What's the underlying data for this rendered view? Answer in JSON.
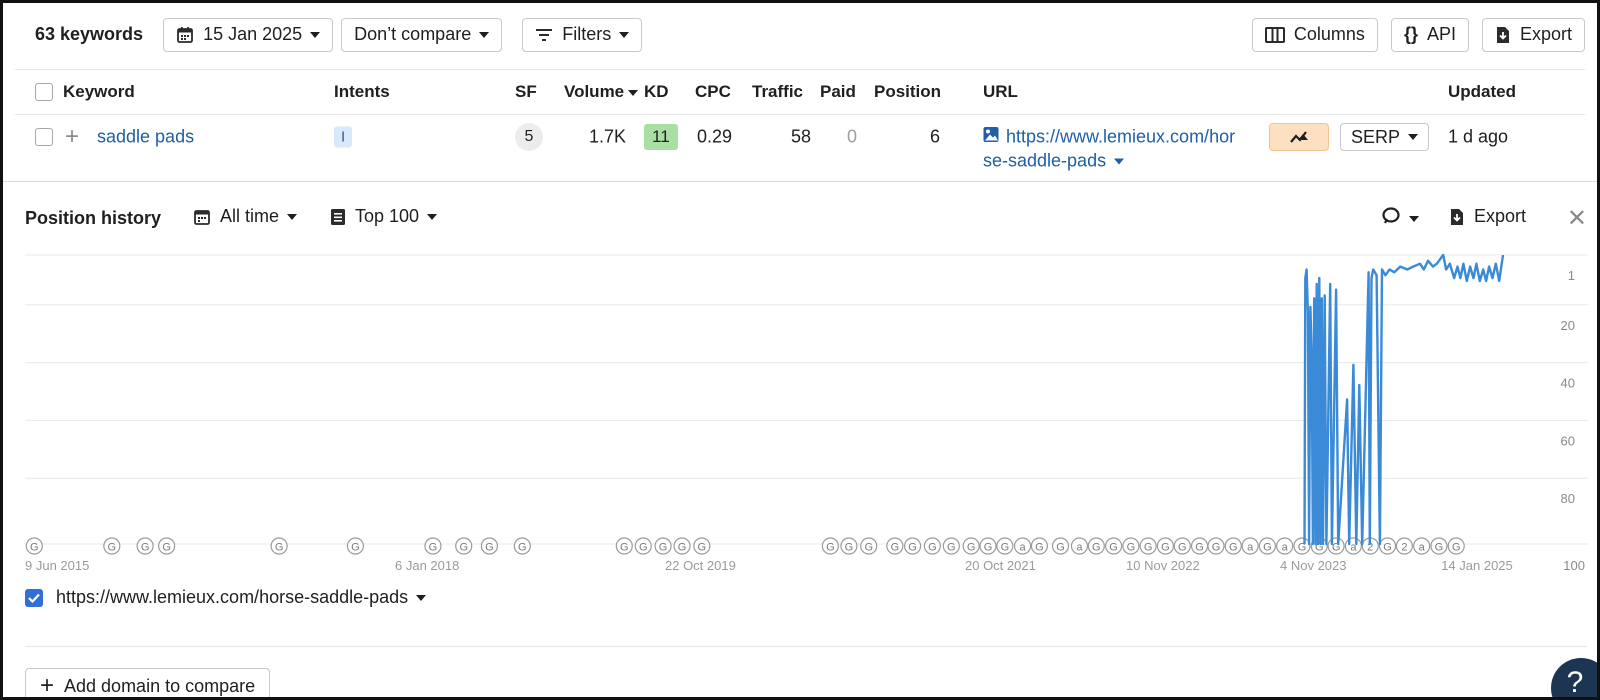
{
  "toolbar": {
    "keyword_count": "63 keywords",
    "date": "15 Jan 2025",
    "compare": "Don’t compare",
    "filters": "Filters",
    "columns": "Columns",
    "api": "API",
    "export": "Export"
  },
  "table": {
    "headers": {
      "keyword": "Keyword",
      "intents": "Intents",
      "sf": "SF",
      "volume": "Volume",
      "kd": "KD",
      "cpc": "CPC",
      "traffic": "Traffic",
      "paid": "Paid",
      "position": "Position",
      "url": "URL",
      "updated": "Updated"
    },
    "row": {
      "keyword": "saddle pads",
      "intent": "I",
      "sf": "5",
      "volume": "1.7K",
      "kd": "11",
      "cpc": "0.29",
      "traffic": "58",
      "paid": "0",
      "position": "6",
      "url_line1": "https://www.lemieux.com/hor",
      "url_line2": "se-saddle-pads",
      "serp": "SERP",
      "updated": "1 d ago"
    }
  },
  "panel": {
    "title": "Position history",
    "range": "All time",
    "top": "Top 100",
    "export": "Export",
    "legend_url": "https://www.lemieux.com/horse-saddle-pads",
    "add_domain": "Add domain to compare",
    "help": "?"
  },
  "colors": {
    "line": "#3a8ad8",
    "link": "#1d5fa8",
    "kd": "#a9dfa3",
    "intent": "#d9e8fb"
  },
  "chart_data": {
    "type": "line",
    "y_axis": {
      "reversed": true,
      "ticks": [
        "1",
        "20",
        "40",
        "60",
        "80",
        "100"
      ],
      "ylim": [
        1,
        100
      ]
    },
    "x_ticks": [
      "9 Jun 2015",
      "6 Jan 2018",
      "22 Oct 2019",
      "20 Oct 2021",
      "10 Nov 2022",
      "4 Nov 2023",
      "14 Jan 2025"
    ],
    "grid": true,
    "series": [
      {
        "values_description_points": [
          [
            "2023-10-01",
            100
          ],
          [
            "2023-10-03",
            8
          ],
          [
            "2023-10-06",
            5
          ],
          [
            "2023-10-09",
            20
          ],
          [
            "2023-10-12",
            100
          ],
          [
            "2023-10-15",
            18
          ],
          [
            "2023-10-18",
            35
          ],
          [
            "2023-10-21",
            100
          ],
          [
            "2023-10-24",
            15
          ],
          [
            "2023-10-27",
            100
          ],
          [
            "2023-10-30",
            10
          ],
          [
            "2023-11-02",
            100
          ],
          [
            "2023-11-05",
            8
          ],
          [
            "2023-11-08",
            100
          ],
          [
            "2023-11-11",
            15
          ],
          [
            "2023-11-14",
            100
          ],
          [
            "2023-11-18",
            14
          ],
          [
            "2023-11-22",
            100
          ],
          [
            "2023-12-01",
            10
          ],
          [
            "2023-12-05",
            100
          ],
          [
            "2023-12-15",
            12
          ],
          [
            "2023-12-20",
            100
          ],
          [
            "2024-01-10",
            50
          ],
          [
            "2024-01-15",
            100
          ],
          [
            "2024-01-25",
            38
          ],
          [
            "2024-02-01",
            100
          ],
          [
            "2024-02-08",
            45
          ],
          [
            "2024-02-15",
            100
          ],
          [
            "2024-03-01",
            6
          ],
          [
            "2024-03-04",
            100
          ],
          [
            "2024-03-08",
            8
          ],
          [
            "2024-03-12",
            5
          ],
          [
            "2024-03-20",
            7
          ],
          [
            "2024-03-28",
            100
          ],
          [
            "2024-04-02",
            5
          ],
          [
            "2024-04-10",
            7
          ],
          [
            "2024-04-20",
            5
          ],
          [
            "2024-05-01",
            6
          ],
          [
            "2024-05-15",
            4
          ],
          [
            "2024-06-01",
            5
          ],
          [
            "2024-06-15",
            4
          ],
          [
            "2024-07-01",
            3
          ],
          [
            "2024-07-10",
            5
          ],
          [
            "2024-07-20",
            2
          ],
          [
            "2024-08-01",
            4
          ],
          [
            "2024-08-10",
            3
          ],
          [
            "2024-08-20",
            1
          ],
          [
            "2024-08-25",
            0
          ],
          [
            "2024-09-01",
            5
          ],
          [
            "2024-09-10",
            3
          ],
          [
            "2024-09-20",
            8
          ],
          [
            "2024-09-28",
            4
          ],
          [
            "2024-10-05",
            8
          ],
          [
            "2024-10-12",
            3
          ],
          [
            "2024-10-20",
            9
          ],
          [
            "2024-10-28",
            4
          ],
          [
            "2024-11-05",
            8
          ],
          [
            "2024-11-12",
            3
          ],
          [
            "2024-11-20",
            9
          ],
          [
            "2024-11-28",
            5
          ],
          [
            "2024-12-05",
            9
          ],
          [
            "2024-12-12",
            4
          ],
          [
            "2024-12-20",
            8
          ],
          [
            "2024-12-28",
            3
          ],
          [
            "2025-01-05",
            9
          ],
          [
            "2025-01-14",
            0
          ]
        ]
      }
    ],
    "markers": [
      {
        "date": "2015-07-01",
        "label": "G"
      },
      {
        "date": "2016-01-01",
        "label": "G"
      },
      {
        "date": "2016-03-20",
        "label": "G"
      },
      {
        "date": "2016-05-10",
        "label": "G"
      },
      {
        "date": "2017-02-01",
        "label": "G"
      },
      {
        "date": "2017-08-01",
        "label": "G"
      },
      {
        "date": "2018-02-01",
        "label": "G"
      },
      {
        "date": "2018-04-15",
        "label": "G"
      },
      {
        "date": "2018-06-15",
        "label": "G"
      },
      {
        "date": "2018-09-01",
        "label": "G"
      },
      {
        "date": "2019-05-01",
        "label": "G"
      },
      {
        "date": "2019-06-15",
        "label": "G"
      },
      {
        "date": "2019-08-01",
        "label": "G"
      },
      {
        "date": "2019-09-15",
        "label": "G"
      },
      {
        "date": "2019-11-01",
        "label": "G"
      },
      {
        "date": "2020-09-01",
        "label": "G"
      },
      {
        "date": "2020-10-15",
        "label": "G"
      },
      {
        "date": "2020-12-01",
        "label": "G"
      },
      {
        "date": "2021-02-01",
        "label": "G"
      },
      {
        "date": "2021-03-15",
        "label": "G"
      },
      {
        "date": "2021-05-01",
        "label": "G"
      },
      {
        "date": "2021-06-15",
        "label": "G"
      },
      {
        "date": "2021-08-01",
        "label": "G"
      },
      {
        "date": "2021-09-10",
        "label": "G"
      },
      {
        "date": "2021-10-20",
        "label": "G"
      },
      {
        "date": "2021-12-01",
        "label": "a"
      },
      {
        "date": "2022-01-10",
        "label": "G"
      },
      {
        "date": "2022-03-01",
        "label": "G"
      },
      {
        "date": "2022-04-15",
        "label": "a"
      },
      {
        "date": "2022-05-25",
        "label": "G"
      },
      {
        "date": "2022-07-05",
        "label": "G"
      },
      {
        "date": "2022-08-15",
        "label": "G"
      },
      {
        "date": "2022-09-25",
        "label": "G"
      },
      {
        "date": "2022-11-05",
        "label": "G"
      },
      {
        "date": "2022-12-15",
        "label": "G"
      },
      {
        "date": "2023-01-25",
        "label": "G"
      },
      {
        "date": "2023-03-05",
        "label": "G"
      },
      {
        "date": "2023-04-15",
        "label": "G"
      },
      {
        "date": "2023-05-25",
        "label": "a"
      },
      {
        "date": "2023-07-05",
        "label": "G"
      },
      {
        "date": "2023-08-15",
        "label": "a"
      },
      {
        "date": "2023-09-25",
        "label": "G"
      },
      {
        "date": "2023-11-05",
        "label": "G"
      },
      {
        "date": "2023-12-15",
        "label": "G"
      },
      {
        "date": "2024-01-25",
        "label": "a"
      },
      {
        "date": "2024-03-05",
        "label": "2"
      },
      {
        "date": "2024-04-15",
        "label": "G"
      },
      {
        "date": "2024-05-25",
        "label": "2"
      },
      {
        "date": "2024-07-05",
        "label": "a"
      },
      {
        "date": "2024-08-15",
        "label": "G"
      },
      {
        "date": "2024-09-25",
        "label": "G"
      }
    ]
  }
}
